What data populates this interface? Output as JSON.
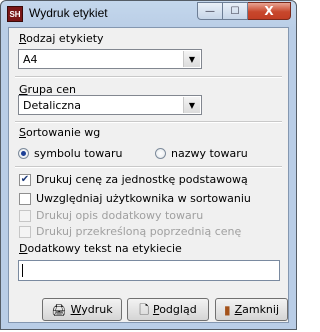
{
  "window": {
    "title": "Wydruk etykiet",
    "app_icon_text": "SH"
  },
  "caption_buttons": {
    "minimize": "—",
    "maximize": "☐",
    "close": "X"
  },
  "rodzaj": {
    "label_prefix": "",
    "label_ul": "R",
    "label_rest": "odzaj etykiety",
    "value": "A4"
  },
  "grupa": {
    "label_ul": "G",
    "label_rest": "rupa cen",
    "value": "Detaliczna"
  },
  "sortowanie": {
    "label_ul": "S",
    "label_rest": "ortowanie wg",
    "options": [
      {
        "label": "symbolu towaru",
        "selected": true
      },
      {
        "label": "nazwy towaru",
        "selected": false
      }
    ]
  },
  "options": [
    {
      "label": "Drukuj cenę za jednostkę podstawową",
      "checked": true,
      "enabled": true
    },
    {
      "label": "Uwzględniaj użytkownika w sortowaniu",
      "checked": false,
      "enabled": true
    },
    {
      "label": "Drukuj opis dodatkowy towaru",
      "checked": false,
      "enabled": false
    },
    {
      "label": "Drukuj przekreśloną poprzednią cenę",
      "checked": false,
      "enabled": false
    }
  ],
  "dodatkowy": {
    "label_ul": "D",
    "label_rest": "odatkowy tekst na etykiecie",
    "value": ""
  },
  "buttons": {
    "wydruk": {
      "label_ul": "W",
      "label_rest": "ydruk",
      "icon": "printer-icon"
    },
    "podglad": {
      "label_ul": "P",
      "label_rest": "odgląd",
      "icon": "preview-icon"
    },
    "zamknij": {
      "label_ul": "Z",
      "label_rest": "amknij",
      "icon": "exit-door-icon"
    }
  }
}
